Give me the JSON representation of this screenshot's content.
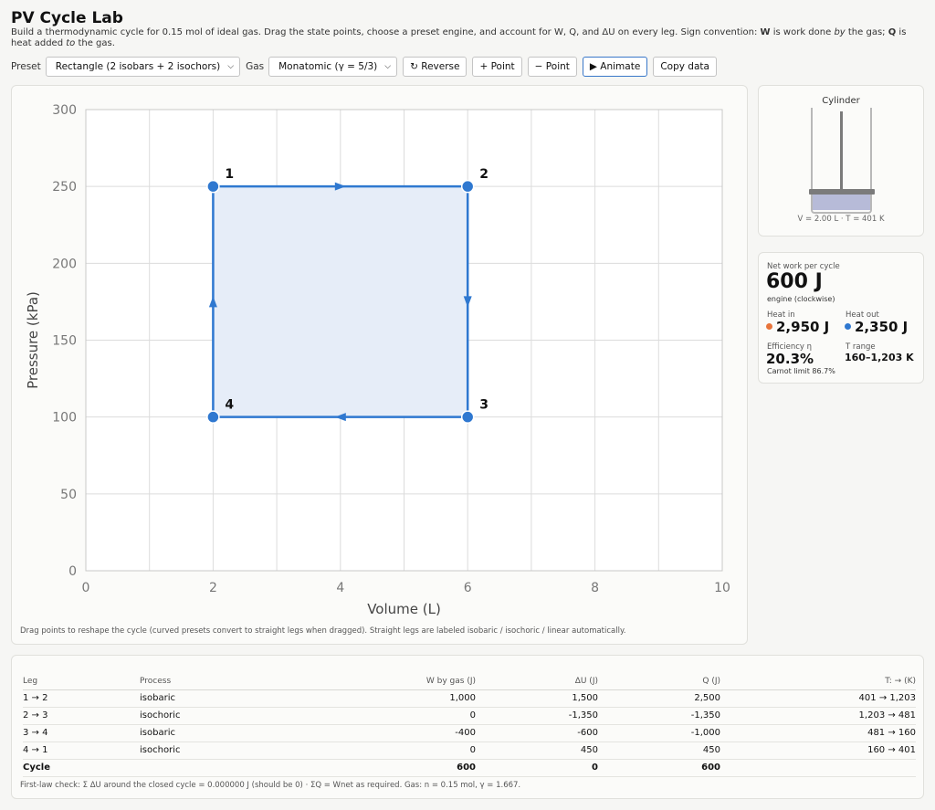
{
  "app": {
    "title": "PV Cycle Lab",
    "description_lead": "Build a thermodynamic cycle for 0.15 mol of ideal gas. Drag the state points, choose a preset engine, and account for W, Q, and ΔU on every leg. Sign convention: ",
    "desc_w": "W",
    "desc_w_text": " is work done ",
    "desc_by": "by",
    "desc_gas1": " the gas; ",
    "desc_q": "Q",
    "desc_q_text": " is heat added ",
    "desc_to": "to",
    "desc_gas2": " the gas."
  },
  "toolbar": {
    "preset_label": "Preset",
    "preset_value": "Rectangle (2 isobars + 2 isochors)",
    "gas_label": "Gas",
    "gas_value": "Monatomic (γ = 5/3)",
    "reverse_label": "↻ Reverse",
    "add_point_label": "+ Point",
    "remove_point_label": "− Point",
    "animate_label": "▶ Animate",
    "copy_label": "Copy data"
  },
  "chart_data": {
    "type": "line",
    "xlabel": "Volume (L)",
    "ylabel": "Pressure (kPa)",
    "xlim": [
      0,
      10
    ],
    "ylim": [
      0,
      300
    ],
    "xticks": [
      0,
      2,
      4,
      6,
      8,
      10
    ],
    "yticks": [
      0,
      50,
      100,
      150,
      200,
      250,
      300
    ],
    "grid": true,
    "points": [
      {
        "label": "1",
        "x": 2,
        "y": 250
      },
      {
        "label": "2",
        "x": 6,
        "y": 250
      },
      {
        "label": "3",
        "x": 6,
        "y": 100
      },
      {
        "label": "4",
        "x": 2,
        "y": 100
      }
    ],
    "line_color": "#2f78d0",
    "fill_color": "#e6edf8"
  },
  "plot_note": "Drag points to reshape the cycle (curved presets convert to straight legs when dragged). Straight legs are labeled isobaric / isochoric / linear automatically.",
  "cylinder": {
    "title": "Cylinder",
    "state": "V = 2.00 L · T = 401 K"
  },
  "stats": {
    "net_work_label": "Net work per cycle",
    "net_work_value": "600 J",
    "mode": "engine (clockwise)",
    "heat_in_label": "Heat in",
    "heat_in_value": "2,950 J",
    "heat_in_color": "#e8743b",
    "heat_out_label": "Heat out",
    "heat_out_value": "2,350 J",
    "heat_out_color": "#2f78d0",
    "efficiency_label": "Efficiency η",
    "efficiency_value": "20.3%",
    "carnot": "Carnot limit 86.7%",
    "trange_label": "T range",
    "trange_value": "160–1,203 K"
  },
  "table": {
    "headers": [
      "Leg",
      "Process",
      "W by gas (J)",
      "ΔU (J)",
      "Q (J)",
      "T: → (K)"
    ],
    "rows": [
      [
        "1 → 2",
        "isobaric",
        "1,000",
        "1,500",
        "2,500",
        "401 → 1,203"
      ],
      [
        "2 → 3",
        "isochoric",
        "0",
        "-1,350",
        "-1,350",
        "1,203 → 481"
      ],
      [
        "3 → 4",
        "isobaric",
        "-400",
        "-600",
        "-1,000",
        "481 → 160"
      ],
      [
        "4 → 1",
        "isochoric",
        "0",
        "450",
        "450",
        "160 → 401"
      ]
    ],
    "total": [
      "Cycle",
      "",
      "600",
      "0",
      "600",
      ""
    ],
    "note": "First-law check: Σ ΔU around the closed cycle = 0.000000 J (should be 0) · ΣQ = Wnet as required. Gas: n = 0.15 mol, γ = 1.667."
  }
}
